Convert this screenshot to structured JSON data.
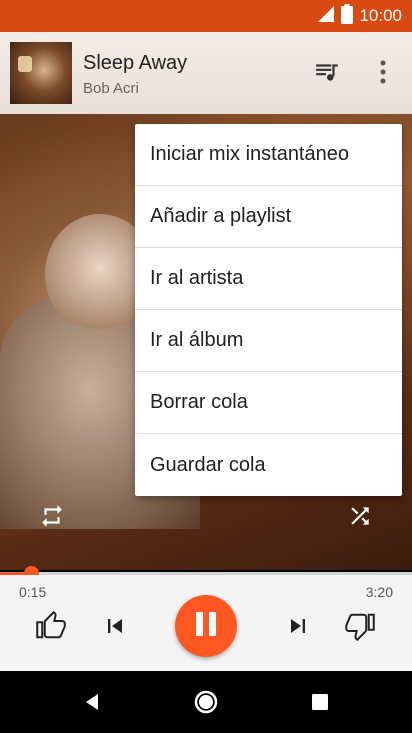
{
  "status_bar": {
    "time": "10:00",
    "icons": [
      "signal-icon",
      "battery-icon"
    ],
    "color": "#d84a12"
  },
  "now_playing": {
    "title": "Sleep Away",
    "artist": "Bob Acri"
  },
  "header": {
    "icons": [
      "queue-music-icon",
      "more-vert-icon"
    ]
  },
  "menu": {
    "items": [
      {
        "label": "Iniciar mix instantáneo"
      },
      {
        "label": "Añadir a playlist"
      },
      {
        "label": "Ir al artista"
      },
      {
        "label": "Ir al álbum"
      },
      {
        "label": "Borrar cola"
      },
      {
        "label": "Guardar cola"
      }
    ]
  },
  "playback": {
    "elapsed": "0:15",
    "duration": "3:20",
    "progress": 0.075,
    "accent_color": "#ff5722",
    "controls": [
      "repeat-icon",
      "shuffle-icon",
      "thumb-up-icon",
      "skip-previous-icon",
      "pause-icon",
      "skip-next-icon",
      "thumb-down-icon"
    ]
  },
  "nav_bar": {
    "icons": [
      "back-icon",
      "home-icon",
      "recents-icon"
    ]
  }
}
